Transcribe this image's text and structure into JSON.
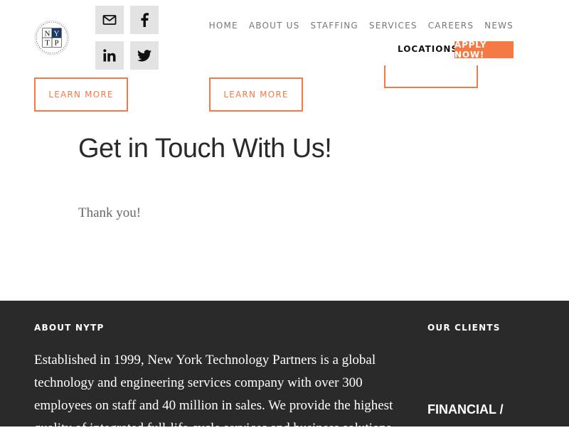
{
  "brand": {
    "logo_letters": [
      "N",
      "Y",
      "T",
      "P"
    ],
    "logo_ring_text": "NEW YORK TECHNOLOGY PARTNERS"
  },
  "social": [
    {
      "name": "email-icon"
    },
    {
      "name": "facebook-icon"
    },
    {
      "name": "linkedin-icon"
    },
    {
      "name": "twitter-icon"
    }
  ],
  "nav": {
    "items": [
      "HOME",
      "ABOUT US",
      "STAFFING",
      "SERVICES",
      "CAREERS",
      "NEWS"
    ],
    "locations": "LOCATIONS",
    "apply": "APPLY NOW!"
  },
  "cards": {
    "learn_more_1": "LEARN MORE",
    "learn_more_2": "LEARN MORE"
  },
  "contact": {
    "heading": "Get in Touch With Us!",
    "message": "Thank you!"
  },
  "footer": {
    "about_title": "ABOUT NYTP",
    "about_text": "Established in 1999, New York Technology Partners is a global technology and engineering services company with over 300 employees on staff and 40 million in sales. We provide the highest quality of integrated full-life cycle services and business solutions",
    "clients_title": "OUR CLIENTS",
    "clients_category": "FINANCIAL /"
  },
  "colors": {
    "accent": "#f47a45",
    "footer_bg": "#2a2a2a",
    "social_bg": "#e3e3e3"
  }
}
